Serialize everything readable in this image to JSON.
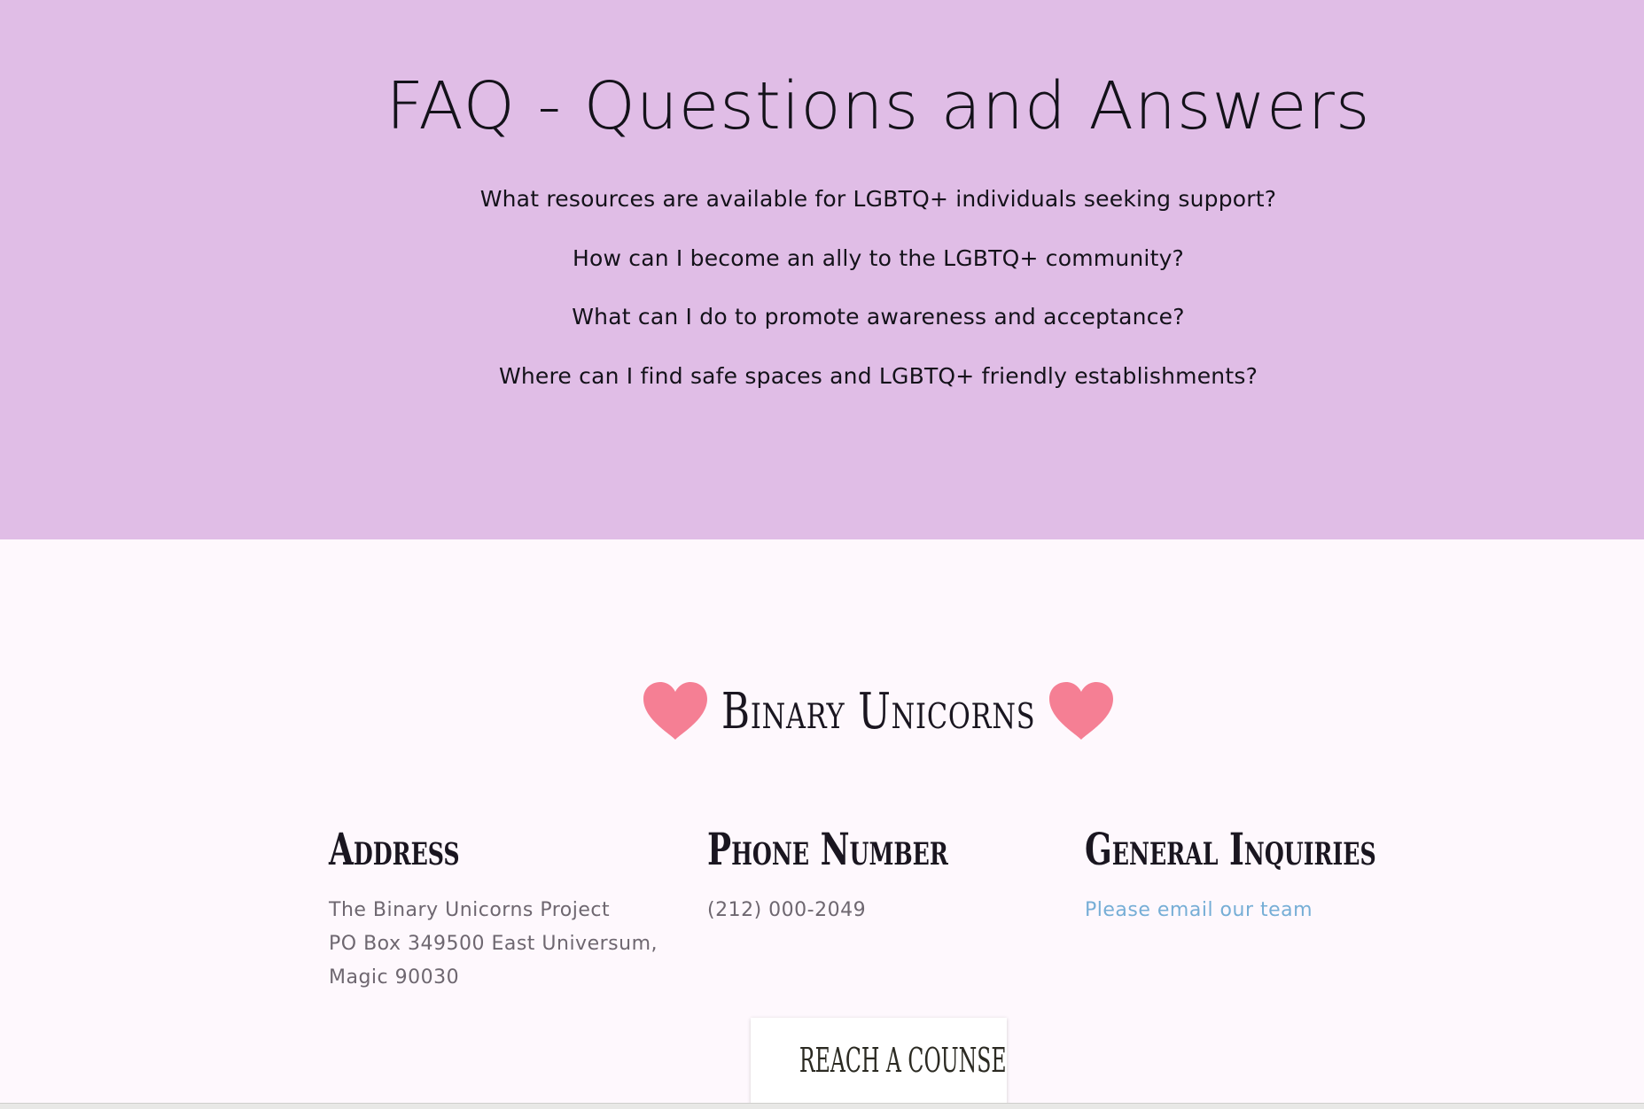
{
  "faq": {
    "title": "FAQ - Questions and Answers",
    "questions": [
      "What resources are available for LGBTQ+ individuals seeking support?",
      "How can I become an ally to the LGBTQ+ community?",
      "What can I do to promote awareness and acceptance?",
      "Where can I find safe spaces and LGBTQ+ friendly establishments?"
    ]
  },
  "footer": {
    "brand": "Binary Unicorns",
    "address": {
      "heading": "Address",
      "lines": [
        "The Binary Unicorns Project",
        "PO Box 349500 East Universum,",
        "Magic 90030"
      ]
    },
    "phone": {
      "heading": "Phone Number",
      "number": "(212) 000-2049"
    },
    "inquiries": {
      "heading": "General Inquiries",
      "link_text": "Please email our team"
    },
    "cta_label": "REACH A COUNSELOR"
  },
  "colors": {
    "faq_background": "#e0bde6",
    "page_background": "#fef8fd",
    "heart": "#f57f94",
    "link": "#76aed6"
  },
  "icons": {
    "brand_left": "heart-icon",
    "brand_right": "heart-icon"
  }
}
